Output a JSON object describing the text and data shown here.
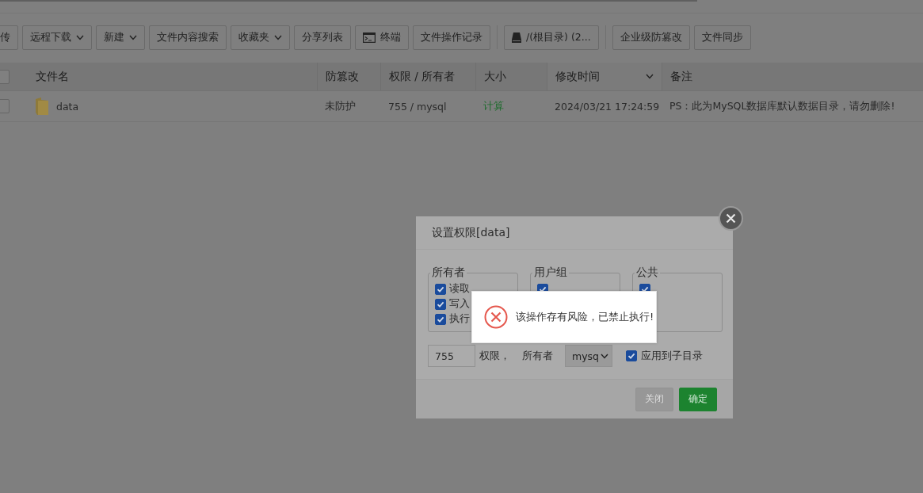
{
  "toolbar": {
    "groups": [
      [
        {
          "label": "传",
          "kind": "plain"
        },
        {
          "label": "远程下载",
          "kind": "dropdown"
        },
        {
          "label": "新建",
          "kind": "dropdown"
        },
        {
          "label": "文件内容搜索",
          "kind": "plain"
        },
        {
          "label": "收藏夹",
          "kind": "dropdown"
        },
        {
          "label": "分享列表",
          "kind": "plain"
        },
        {
          "label": "终端",
          "kind": "terminal"
        },
        {
          "label": "文件操作记录",
          "kind": "plain"
        }
      ],
      [
        {
          "label": "/(根目录) (2...",
          "kind": "disk"
        }
      ],
      [
        {
          "label": "企业级防篡改",
          "kind": "plain"
        },
        {
          "label": "文件同步",
          "kind": "plain"
        }
      ]
    ]
  },
  "table": {
    "select_all": {
      "checked": false
    },
    "columns": [
      {
        "label": "文件名",
        "sorted": false
      },
      {
        "label": "防篡改",
        "sorted": false
      },
      {
        "label": "权限 / 所有者",
        "sorted": false
      },
      {
        "label": "大小",
        "sorted": false
      },
      {
        "label": "修改时间",
        "sorted": true
      },
      {
        "label": "备注",
        "sorted": false
      }
    ],
    "rows": [
      {
        "checked": false,
        "name": "data",
        "tamper": "未防护",
        "permission": "755 / mysql",
        "size": "计算",
        "modified": "2024/03/21 17:24:59",
        "note": "PS：此为MySQL数据库默认数据目录，请勿删除!"
      }
    ]
  },
  "dialog": {
    "title": "设置权限[data]",
    "groups": [
      {
        "label": "所有者",
        "perms": [
          {
            "label": "读取",
            "checked": true
          },
          {
            "label": "写入",
            "checked": true
          },
          {
            "label": "执行",
            "checked": true
          }
        ]
      },
      {
        "label": "用户组",
        "perms": [
          {
            "checked": true
          }
        ]
      },
      {
        "label": "公共",
        "perms": [
          {
            "checked": true
          }
        ]
      }
    ],
    "mode": "755",
    "mode_label": "权限，",
    "owner_label": "所有者",
    "owner": "mysq",
    "apply_subdirs": {
      "label": "应用到子目录",
      "checked": true
    },
    "buttons": [
      {
        "label": "关闭",
        "kind": "secondary"
      },
      {
        "label": "确定",
        "kind": "primary"
      }
    ]
  },
  "toast": {
    "message": "该操作存有风险，已禁止执行!"
  }
}
